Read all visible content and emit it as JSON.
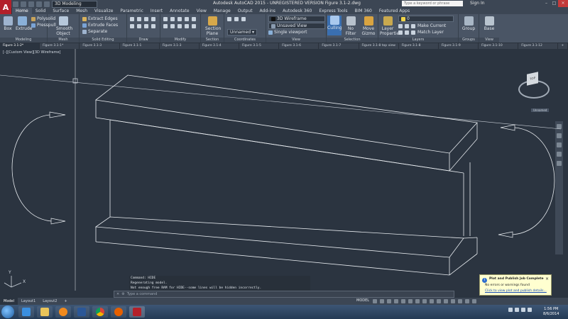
{
  "app": {
    "logo_letter": "A",
    "title": "Autodesk AutoCAD 2015 - UNREGISTERED VERSION     Figure 3.1-2.dwg",
    "workspace": "3D Modeling",
    "search_placeholder": "Type a keyword or phrase",
    "sign_in": "Sign In"
  },
  "ribbon_tabs": [
    "Home",
    "Solid",
    "Surface",
    "Mesh",
    "Visualize",
    "Parametric",
    "Insert",
    "Annotate",
    "View",
    "Manage",
    "Output",
    "Add-ins",
    "Autodesk 360",
    "Express Tools",
    "BIM 360",
    "Featured Apps"
  ],
  "ribbon": {
    "modeling": {
      "label": "Modeling",
      "box": "Box",
      "extrude": "Extrude",
      "polysolid": "Polysolid",
      "presspull": "Presspull"
    },
    "mesh": {
      "label": "Mesh",
      "smooth": "Smooth Object"
    },
    "solid_editing": {
      "label": "Solid Editing",
      "extract_edges": "Extract Edges",
      "extrude_faces": "Extrude Faces",
      "separate": "Separate"
    },
    "draw": {
      "label": "Draw"
    },
    "modify": {
      "label": "Modify"
    },
    "section": {
      "label": "Section",
      "section_plane": "Section Plane"
    },
    "coordinates": {
      "label": "Coordinates",
      "unnamed": "Unnamed"
    },
    "view": {
      "label": "View",
      "visual_style": "3D Wireframe",
      "unsaved_view": "Unsaved View",
      "single_viewport": "Single viewport"
    },
    "selection": {
      "label": "Selection",
      "culling": "Culling",
      "no_filter": "No Filter",
      "move_gizmo": "Move Gizmo"
    },
    "layers": {
      "label": "Layers",
      "layer_properties": "Layer Properties",
      "layer_value": "0",
      "make_current": "Make Current",
      "match_layer": "Match Layer"
    },
    "groups": {
      "label": "Groups",
      "group": "Group"
    },
    "view2": {
      "label": "View",
      "base": "Base"
    }
  },
  "doc_tabs": [
    "Figure 3.1-2*",
    "Figure 3.1-1*",
    "Figure 3.1-3",
    "Figure 3.1-1",
    "Figure 3.1-3",
    "Figure 3.1-4",
    "Figure 3.1-5",
    "Figure 3.1-6",
    "Figure 3.1-7",
    "Figure 3.1-8 top view",
    "Figure 3.1-8",
    "Figure 3.1-9",
    "Figure 3.1-10",
    "Figure 3.1-12"
  ],
  "viewport": {
    "label": "[–][Custom View][3D Wireframe]",
    "viewcube_face": "TOP",
    "ucs_badge": "Unnamed",
    "axis_y": "Y",
    "axis_x": "X"
  },
  "command": {
    "history": [
      "Command: HIDE",
      "Regenerating model.",
      "Not enough free RAM for HIDE--some lines will be hidden incorrectly."
    ],
    "placeholder": "Type a command"
  },
  "notification": {
    "title": "Plot and Publish Job Complete",
    "message": "No errors or warnings found",
    "link": "Click to view plot and publish details..."
  },
  "layout_tabs": [
    "Model",
    "Layout1",
    "Layout2"
  ],
  "status": {
    "model": "MODEL"
  },
  "clock": {
    "time": "1:56 PM",
    "date": "8/6/2014"
  },
  "colors": {
    "accent": "#b3202a",
    "ribbon": "#4a5565",
    "viewport": "#2b3440"
  }
}
